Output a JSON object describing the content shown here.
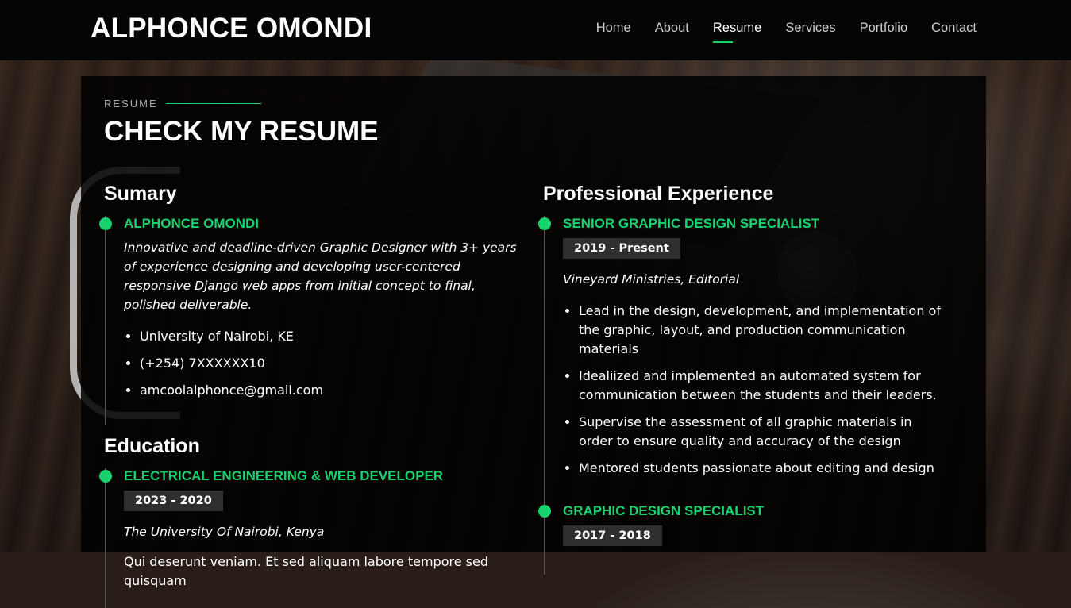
{
  "header": {
    "logo": "ALPHONCE OMONDI",
    "nav": [
      {
        "label": "Home"
      },
      {
        "label": "About"
      },
      {
        "label": "Resume"
      },
      {
        "label": "Services"
      },
      {
        "label": "Portfolio"
      },
      {
        "label": "Contact"
      }
    ],
    "active_nav": "Resume"
  },
  "section": {
    "label": "RESUME",
    "title": "CHECK MY RESUME"
  },
  "summary": {
    "heading": "Sumary",
    "name": "ALPHONCE OMONDI",
    "description": "Innovative and deadline-driven Graphic Designer with 3+ years of experience designing and developing user-centered responsive Django web apps from initial concept to final, polished deliverable.",
    "contacts": [
      "University of Nairobi, KE",
      "(+254) 7XXXXXX10",
      "amcoolalphonce@gmail.com"
    ]
  },
  "education": {
    "heading": "Education",
    "items": [
      {
        "title": "ELECTRICAL ENGINEERING & WEB DEVELOPER",
        "date": "2023 - 2020",
        "school": "The University Of Nairobi, Kenya",
        "text": "Qui deserunt veniam. Et sed aliquam labore tempore sed quisquam"
      }
    ]
  },
  "experience": {
    "heading": "Professional Experience",
    "items": [
      {
        "title": "SENIOR GRAPHIC DESIGN SPECIALIST",
        "date": "2019 - Present",
        "org": "Vineyard Ministries, Editorial",
        "bullets": [
          "Lead in the design, development, and implementation of the graphic, layout, and production communication materials",
          "Idealiized and implemented an automated system for communication between the students and their leaders.",
          "Supervise the assessment of all graphic materials in order to ensure quality and accuracy of the design",
          "Mentored students passionate about editing and design"
        ]
      },
      {
        "title": "GRAPHIC DESIGN SPECIALIST",
        "date": "2017 - 2018"
      }
    ]
  },
  "colors": {
    "accent": "#18d26e",
    "header_bg": "#050505",
    "panel_bg": "#000000",
    "date_badge_bg": "#2f2f2f"
  }
}
